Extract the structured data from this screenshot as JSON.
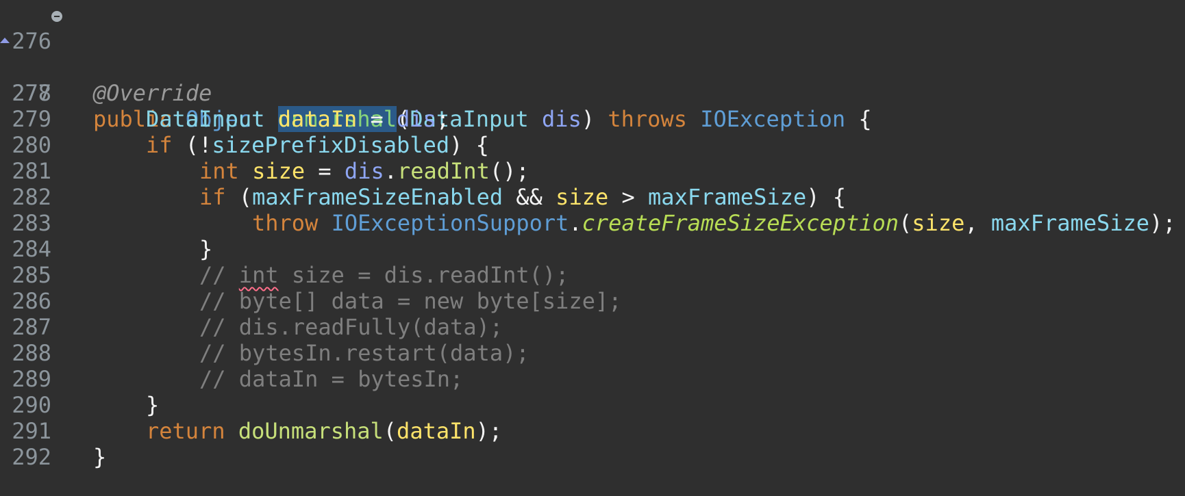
{
  "editor": {
    "language": "Java",
    "lines": [
      {
        "num": "276",
        "segments": [
          "@Override"
        ]
      },
      {
        "num": "277",
        "segments": [
          "public",
          " ",
          "Object",
          " ",
          "unmarshal",
          "(",
          "DataInput",
          " ",
          "dis",
          ") ",
          "throws",
          " ",
          "IOException",
          " {"
        ]
      },
      {
        "num": "278",
        "segments": [
          "DataInput",
          " ",
          "dataIn",
          " = ",
          "dis",
          ";"
        ]
      },
      {
        "num": "279",
        "segments": [
          "if",
          " (!",
          "sizePrefixDisabled",
          ") {"
        ]
      },
      {
        "num": "280",
        "segments": [
          "int",
          " ",
          "size",
          " = ",
          "dis",
          ".",
          "readInt",
          "();"
        ]
      },
      {
        "num": "281",
        "segments": [
          "if",
          " (",
          "maxFrameSizeEnabled",
          " && ",
          "size",
          " > ",
          "maxFrameSize",
          ") {"
        ]
      },
      {
        "num": "282",
        "segments": [
          "throw",
          " ",
          "IOExceptionSupport",
          ".",
          "createFrameSizeException",
          "(",
          "size",
          ", ",
          "maxFrameSize",
          ");"
        ]
      },
      {
        "num": "283",
        "segments": [
          "}"
        ]
      },
      {
        "num": "284",
        "segments": [
          "// ",
          "int",
          " size = dis.readInt();"
        ]
      },
      {
        "num": "285",
        "segments": [
          "// byte[] data = new byte[size];"
        ]
      },
      {
        "num": "286",
        "segments": [
          "// dis.readFully(data);"
        ]
      },
      {
        "num": "287",
        "segments": [
          "// bytesIn.restart(data);"
        ]
      },
      {
        "num": "288",
        "segments": [
          "// dataIn = bytesIn;"
        ]
      },
      {
        "num": "289",
        "segments": [
          "}"
        ]
      },
      {
        "num": "290",
        "segments": [
          "return",
          " ",
          "doUnmarshal",
          "(",
          "dataIn",
          ");"
        ]
      },
      {
        "num": "291",
        "segments": [
          "}"
        ]
      },
      {
        "num": "292",
        "segments": []
      }
    ]
  },
  "colors": {
    "background": "#2f2f2f",
    "keyword": "#d4843c",
    "selection": "#2b5a88",
    "comment": "#7f7f7f",
    "line_number": "#8c959c"
  },
  "icons": {
    "fold": "collapse-minus-icon",
    "override": "override-triangle-icon"
  }
}
